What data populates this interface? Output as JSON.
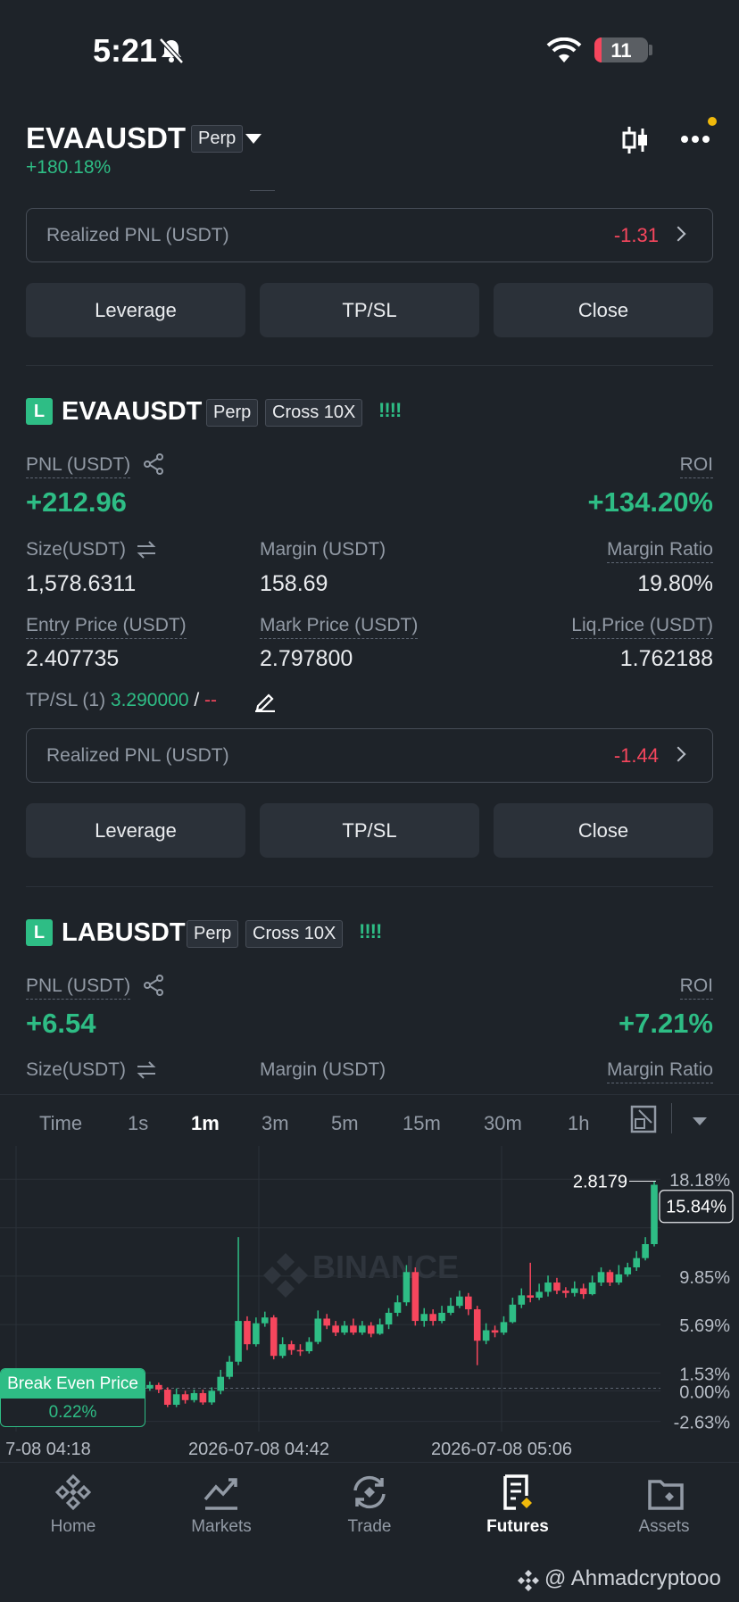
{
  "status": {
    "time": "5:21",
    "battery": "11"
  },
  "header": {
    "symbol": "EVAAUSDT",
    "tag": "Perp",
    "change": "+180.18%"
  },
  "position0": {
    "realized_label": "Realized PNL (USDT)",
    "realized_value": "-1.31",
    "buttons": {
      "leverage": "Leverage",
      "tpsl": "TP/SL",
      "close": "Close"
    }
  },
  "position1": {
    "logo": "L",
    "symbol": "EVAAUSDT",
    "type": "Perp",
    "mode": "Cross 10X",
    "bars": "!!!!",
    "pnl_label": "PNL (USDT)",
    "pnl_value": "+212.96",
    "roi_label": "ROI",
    "roi_value": "+134.20%",
    "size_label": "Size(USDT)",
    "size_value": "1,578.6311",
    "margin_label": "Margin (USDT)",
    "margin_value": "158.69",
    "mratio_label": "Margin Ratio",
    "mratio_value": "19.80%",
    "entry_label": "Entry Price (USDT)",
    "entry_value": "2.407735",
    "mark_label": "Mark Price (USDT)",
    "mark_value": "2.797800",
    "liq_label": "Liq.Price (USDT)",
    "liq_value": "1.762188",
    "tpsl_label": "TP/SL (1)",
    "tp_value": "3.290000",
    "tpsl_sep": "/",
    "sl_value": "--",
    "realized_label": "Realized PNL (USDT)",
    "realized_value": "-1.44",
    "buttons": {
      "leverage": "Leverage",
      "tpsl": "TP/SL",
      "close": "Close"
    }
  },
  "position2": {
    "logo": "L",
    "symbol": "LABUSDT",
    "type": "Perp",
    "mode": "Cross 10X",
    "bars": "!!!!",
    "pnl_label": "PNL (USDT)",
    "pnl_value": "+6.54",
    "roi_label": "ROI",
    "roi_value": "+7.21%",
    "size_label": "Size(USDT)",
    "margin_label": "Margin (USDT)",
    "mratio_label": "Margin Ratio"
  },
  "chart": {
    "timeframes": [
      "Time",
      "1s",
      "1m",
      "3m",
      "5m",
      "15m",
      "30m",
      "1h"
    ],
    "active_timeframe": "1m",
    "watermark": "BINANCE",
    "price_label": "2.8179",
    "current_pct": "15.84%",
    "axis_pcts": [
      "18.18%",
      "9.85%",
      "5.69%",
      "1.53%",
      "0.00%",
      "-2.63%"
    ],
    "time_labels": [
      "7-08 04:18",
      "2026-07-08 04:42",
      "2026-07-08 05:06"
    ],
    "break_even_label": "Break Even Price",
    "break_even_value": "0.22%"
  },
  "chart_data": {
    "type": "candlestick",
    "y_unit": "% from entry",
    "ylim": [
      -3.5,
      19.5
    ],
    "candles": [
      [
        0.3,
        0.2,
        0.6,
        -0.1
      ],
      [
        0.2,
        0.5,
        0.8,
        0.0
      ],
      [
        0.5,
        0.1,
        0.7,
        -0.2
      ],
      [
        0.1,
        -1.2,
        0.3,
        -1.4
      ],
      [
        -1.2,
        -0.3,
        0.2,
        -1.4
      ],
      [
        -0.3,
        -0.8,
        0.0,
        -1.1
      ],
      [
        -0.8,
        -0.2,
        0.1,
        -1.0
      ],
      [
        -0.2,
        -1.0,
        0.1,
        -1.2
      ],
      [
        -1.0,
        0.0,
        0.3,
        -1.2
      ],
      [
        0.0,
        1.2,
        1.8,
        -0.3
      ],
      [
        1.2,
        2.5,
        3.0,
        1.0
      ],
      [
        2.5,
        6.0,
        13.2,
        2.2
      ],
      [
        6.0,
        4.0,
        6.4,
        3.5
      ],
      [
        4.0,
        5.8,
        6.3,
        3.8
      ],
      [
        5.8,
        6.3,
        6.8,
        5.5
      ],
      [
        6.3,
        3.0,
        6.5,
        2.7
      ],
      [
        3.0,
        4.0,
        4.6,
        2.8
      ],
      [
        4.0,
        3.5,
        4.3,
        3.1
      ],
      [
        3.5,
        3.4,
        4.0,
        3.0
      ],
      [
        3.4,
        4.2,
        4.6,
        3.2
      ],
      [
        4.2,
        6.2,
        6.9,
        4.0
      ],
      [
        6.2,
        5.6,
        6.6,
        5.3
      ],
      [
        5.6,
        5.0,
        6.0,
        4.7
      ],
      [
        5.0,
        5.6,
        6.0,
        4.8
      ],
      [
        5.6,
        5.0,
        6.2,
        4.8
      ],
      [
        5.0,
        5.6,
        6.0,
        4.8
      ],
      [
        5.6,
        4.9,
        5.9,
        4.6
      ],
      [
        4.9,
        5.7,
        6.2,
        4.8
      ],
      [
        5.7,
        6.7,
        7.1,
        5.3
      ],
      [
        6.7,
        7.6,
        8.2,
        6.4
      ],
      [
        7.6,
        10.2,
        10.8,
        7.3
      ],
      [
        10.2,
        6.0,
        10.6,
        5.6
      ],
      [
        6.0,
        6.6,
        7.1,
        5.5
      ],
      [
        6.6,
        6.0,
        7.0,
        5.6
      ],
      [
        6.0,
        6.7,
        7.3,
        5.8
      ],
      [
        6.7,
        7.3,
        8.0,
        6.5
      ],
      [
        7.3,
        8.1,
        8.6,
        7.1
      ],
      [
        8.1,
        7.0,
        8.4,
        6.5
      ],
      [
        7.0,
        4.3,
        7.3,
        2.2
      ],
      [
        4.3,
        5.2,
        5.8,
        4.0
      ],
      [
        5.2,
        5.0,
        5.6,
        4.6
      ],
      [
        5.0,
        5.9,
        6.4,
        4.8
      ],
      [
        5.9,
        7.4,
        8.0,
        5.8
      ],
      [
        7.4,
        8.2,
        8.8,
        7.1
      ],
      [
        8.2,
        8.0,
        11.0,
        7.6
      ],
      [
        8.0,
        8.5,
        9.2,
        7.8
      ],
      [
        8.5,
        9.3,
        9.9,
        8.1
      ],
      [
        9.3,
        8.6,
        9.7,
        8.3
      ],
      [
        8.6,
        8.4,
        8.9,
        8.0
      ],
      [
        8.4,
        8.8,
        9.4,
        8.1
      ],
      [
        8.8,
        8.3,
        9.2,
        7.9
      ],
      [
        8.3,
        9.3,
        9.9,
        8.2
      ],
      [
        9.3,
        10.2,
        10.6,
        9.0
      ],
      [
        10.2,
        9.3,
        10.4,
        9.0
      ],
      [
        9.3,
        10.0,
        10.8,
        9.1
      ],
      [
        10.0,
        10.6,
        11.0,
        9.8
      ],
      [
        10.6,
        11.4,
        12.0,
        10.3
      ],
      [
        11.4,
        12.6,
        13.2,
        11.2
      ],
      [
        12.6,
        17.7,
        18.0,
        12.4
      ]
    ]
  },
  "nav": {
    "items": [
      {
        "label": "Home"
      },
      {
        "label": "Markets"
      },
      {
        "label": "Trade"
      },
      {
        "label": "Futures"
      },
      {
        "label": "Assets"
      }
    ]
  },
  "credit": "@ Ahmadcryptooo",
  "colors": {
    "bg": "#1e2329",
    "green": "#2ebd85",
    "red": "#f6465d",
    "accent": "#f0b90b"
  }
}
